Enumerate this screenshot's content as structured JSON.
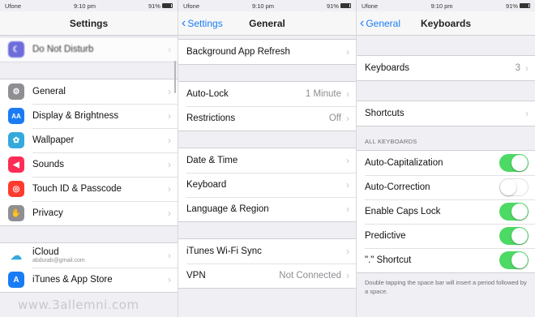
{
  "status": {
    "carrier": "Ufone",
    "time": "9:10 pm",
    "battery": "91%"
  },
  "screen1": {
    "title": "Settings",
    "rows_top": [
      {
        "label": "Do Not Disturb",
        "icon": "moon-icon",
        "color": "#5856d6"
      }
    ],
    "rows_mid": [
      {
        "label": "General",
        "icon": "gear-icon",
        "color": "#8e8e93"
      },
      {
        "label": "Display & Brightness",
        "icon": "text-size-icon",
        "color": "#1a7cf5"
      },
      {
        "label": "Wallpaper",
        "icon": "flower-icon",
        "color": "#34aadc"
      },
      {
        "label": "Sounds",
        "icon": "speaker-icon",
        "color": "#ff2d55"
      },
      {
        "label": "Touch ID & Passcode",
        "icon": "fingerprint-icon",
        "color": "#ff3b30"
      },
      {
        "label": "Privacy",
        "icon": "hand-icon",
        "color": "#8e8e93"
      }
    ],
    "icloud": {
      "label": "iCloud",
      "sub": "abdurab@gmail.com"
    },
    "itunes": {
      "label": "iTunes & App Store"
    }
  },
  "screen2": {
    "back": "Settings",
    "title": "General",
    "bg_refresh": "Background App Refresh",
    "autolock": {
      "label": "Auto-Lock",
      "value": "1 Minute"
    },
    "restrictions": {
      "label": "Restrictions",
      "value": "Off"
    },
    "date_time": "Date & Time",
    "keyboard": "Keyboard",
    "language": "Language & Region",
    "itunes_sync": "iTunes Wi-Fi Sync",
    "vpn": {
      "label": "VPN",
      "value": "Not Connected"
    }
  },
  "screen3": {
    "back": "General",
    "title": "Keyboards",
    "keyboards": {
      "label": "Keyboards",
      "value": "3"
    },
    "shortcuts": "Shortcuts",
    "section": "ALL KEYBOARDS",
    "toggles": [
      {
        "label": "Auto-Capitalization",
        "on": true
      },
      {
        "label": "Auto-Correction",
        "on": false
      },
      {
        "label": "Enable Caps Lock",
        "on": true
      },
      {
        "label": "Predictive",
        "on": true
      },
      {
        "label": "\".\" Shortcut",
        "on": true
      }
    ],
    "footnote": "Double tapping the space bar will insert a period followed by a space."
  },
  "watermark": "www.3allemni.com"
}
